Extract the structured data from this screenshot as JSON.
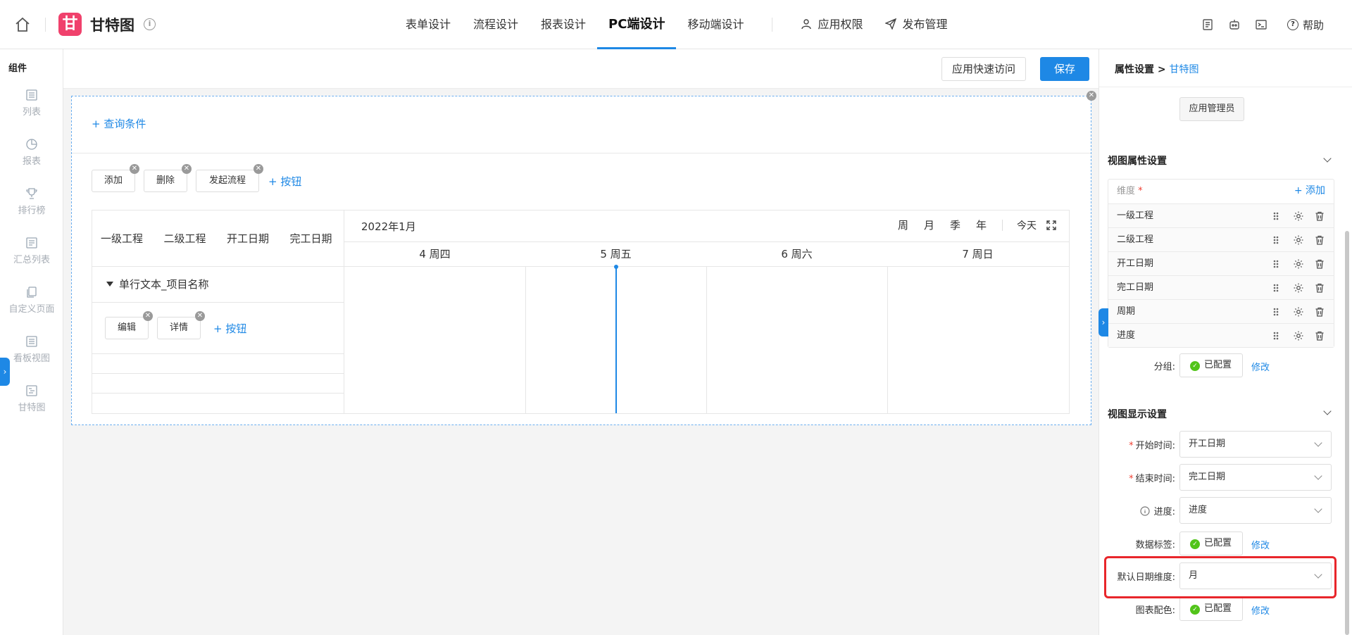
{
  "app": {
    "name": "甘特图",
    "logo_char": "甘",
    "logo_color": "#f0416c",
    "accent_color": "#1e88e5"
  },
  "topnav": {
    "items": [
      {
        "label": "表单设计"
      },
      {
        "label": "流程设计"
      },
      {
        "label": "报表设计"
      },
      {
        "label": "PC端设计",
        "active": true
      },
      {
        "label": "移动端设计"
      }
    ],
    "permissions": "应用权限",
    "publish": "发布管理",
    "help": "帮助"
  },
  "sidebar": {
    "title": "组件",
    "items": [
      {
        "label": "列表",
        "icon": "list-icon"
      },
      {
        "label": "报表",
        "icon": "pie-chart-icon"
      },
      {
        "label": "排行榜",
        "icon": "trophy-icon"
      },
      {
        "label": "汇总列表",
        "icon": "summary-list-icon"
      },
      {
        "label": "自定义页面",
        "icon": "page-copy-icon"
      },
      {
        "label": "看板视图",
        "icon": "kanban-icon"
      },
      {
        "label": "甘特图",
        "icon": "gantt-icon"
      }
    ]
  },
  "toolbar": {
    "quick_access": "应用快速访问",
    "save": "保存"
  },
  "design": {
    "query_conditions": "+ 查询条件",
    "action_buttons": [
      "添加",
      "删除",
      "发起流程"
    ],
    "add_button": "+ 按钮",
    "gantt": {
      "columns": [
        "一级工程",
        "二级工程",
        "开工日期",
        "完工日期"
      ],
      "group_label": "单行文本_项目名称",
      "row_buttons": [
        "编辑",
        "详情"
      ],
      "row_add_button": "+ 按钮",
      "month": "2022年1月",
      "scales": [
        "周",
        "月",
        "季",
        "年"
      ],
      "today": "今天",
      "days": [
        "4 周四",
        "5 周五",
        "6 周六",
        "7 周日"
      ]
    }
  },
  "panel": {
    "breadcrumb_root": "属性设置",
    "breadcrumb_sep": ">",
    "breadcrumb_current": "甘特图",
    "admin_button": "应用管理员",
    "view_attr_title": "视图属性设置",
    "dimension_label": "维度",
    "dimension_required": "*",
    "dimension_add": "+ 添加",
    "dimensions": [
      "一级工程",
      "二级工程",
      "开工日期",
      "完工日期",
      "周期",
      "进度"
    ],
    "group_label": "分组:",
    "configured": "已配置",
    "modify": "修改",
    "view_display_title": "视图显示设置",
    "start_time_label": "开始时间:",
    "start_time_value": "开工日期",
    "end_time_label": "结束时间:",
    "end_time_value": "完工日期",
    "progress_label": "进度:",
    "progress_value": "进度",
    "data_tag_label": "数据标签:",
    "default_date_label": "默认日期维度:",
    "default_date_value": "月",
    "chart_color_label": "图表配色:",
    "highlight_color": "#e8262b"
  }
}
